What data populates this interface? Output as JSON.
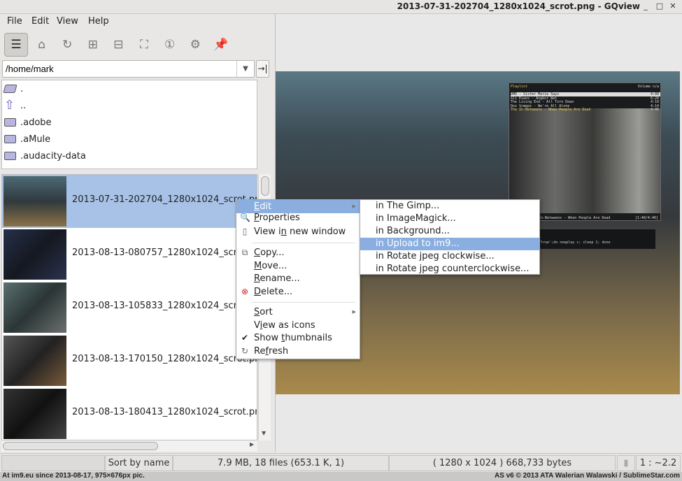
{
  "window": {
    "title": "2013-07-31-202704_1280x1024_scrot.png - GQview",
    "buttons": [
      "_",
      "□",
      "✕"
    ]
  },
  "menubar": [
    "File",
    "Edit",
    "View",
    "Help"
  ],
  "toolbar": [
    {
      "name": "thumbnails-toggle",
      "icon": "list-icon",
      "glyph": "☰",
      "active": true
    },
    {
      "name": "home",
      "icon": "home-icon",
      "glyph": "⌂"
    },
    {
      "name": "refresh",
      "icon": "refresh-icon",
      "glyph": "↻"
    },
    {
      "name": "zoom-in",
      "icon": "zoom-in-icon",
      "glyph": "⊞"
    },
    {
      "name": "zoom-out",
      "icon": "zoom-out-icon",
      "glyph": "⊟"
    },
    {
      "name": "zoom-fit",
      "icon": "fit-icon",
      "glyph": "⛶"
    },
    {
      "name": "zoom-1-1",
      "icon": "actual-size-icon",
      "glyph": "①"
    },
    {
      "name": "preferences",
      "icon": "preferences-icon",
      "glyph": "⚙"
    },
    {
      "name": "float",
      "icon": "pin-icon",
      "glyph": "📌"
    }
  ],
  "path": {
    "value": "/home/mark",
    "go_glyph": "→|"
  },
  "dirs": [
    {
      "name": ".",
      "icon": "open-folder-icon"
    },
    {
      "name": "..",
      "icon": "up-arrow-icon"
    },
    {
      "name": ".adobe",
      "icon": "folder-icon"
    },
    {
      "name": ".aMule",
      "icon": "folder-icon"
    },
    {
      "name": ".audacity-data",
      "icon": "folder-icon"
    }
  ],
  "files": [
    {
      "name": "2013-07-31-202704_1280x1024_scrot.png",
      "selected": true,
      "thumb": "linear-gradient(180deg,#4d6a74,#30393e 50%,#8a7246)"
    },
    {
      "name": "2013-08-13-080757_1280x1024_scrot.png",
      "thumb": "linear-gradient(135deg,#25304a,#151820 50%,#2a3350)"
    },
    {
      "name": "2013-08-13-105833_1280x1024_scrot.png",
      "thumb": "linear-gradient(135deg,#5a7070,#2b3535 50%,#6b7070)"
    },
    {
      "name": "2013-08-13-170150_1280x1024_scrot.png",
      "thumb": "linear-gradient(135deg,#555,#222 50%,#7a5a3a)"
    },
    {
      "name": "2013-08-13-180413_1280x1024_scrot.png",
      "thumb": "linear-gradient(135deg,#333,#111 50%,#444)"
    }
  ],
  "context_menu": {
    "items": [
      {
        "label": "Edit",
        "mn": "E",
        "highlight": true,
        "submenu": true
      },
      {
        "label": "Properties",
        "mn": "P",
        "icon": "properties-icon",
        "glyph": "🔍"
      },
      {
        "label": "View in new window",
        "mn": "n",
        "icon": "new-window-icon",
        "glyph": "▯"
      },
      {
        "sep": true
      },
      {
        "label": "Copy...",
        "mn": "C",
        "icon": "copy-icon",
        "glyph": "⧉"
      },
      {
        "label": "Move...",
        "mn": "M"
      },
      {
        "label": "Rename...",
        "mn": "R"
      },
      {
        "label": "Delete...",
        "mn": "D",
        "icon": "delete-icon",
        "glyph": "⊗"
      },
      {
        "sep": true
      },
      {
        "label": "Sort",
        "mn": "S",
        "submenu": true
      },
      {
        "label": "View as icons",
        "mn": "i"
      },
      {
        "label": "Show thumbnails",
        "mn": "t",
        "icon": "check-icon",
        "glyph": "✔"
      },
      {
        "label": "Refresh",
        "mn": "f",
        "icon": "refresh-icon",
        "glyph": "↻"
      }
    ],
    "edit_submenu": [
      "in The Gimp...",
      "in ImageMagick...",
      "in Background...",
      "in Upload to im9...",
      "in Rotate jpeg clockwise...",
      "in Rotate jpeg counterclockwise..."
    ],
    "edit_submenu_highlight": 3
  },
  "preview": {
    "player_title": "Playlist",
    "player_volume": "Volume n/a",
    "tracks": [
      [
        "DMD - Sister Marie Says",
        "4:00"
      ],
      [
        "Gli Evans - Angkor Wat",
        "6:26"
      ],
      [
        "The Living End - All Torn Down",
        "4:10"
      ],
      [
        "Doz Scmpps - We're All Alone",
        "4:14"
      ],
      [
        "The In-Betweens - When People Are Dead",
        "4:46"
      ]
    ],
    "now_playing": "The In-Betweens - When People Are Dead",
    "time": "[1:40/4:46]",
    "term_line1": "playing",
    "term_line2": "] while '/bin/true';do  nowplay c; sleep 1; done"
  },
  "status": {
    "sort": "Sort by name",
    "files": "7.9 MB, 18 files (653.1 K, 1)",
    "image": "( 1280 x 1024 ) 668,733 bytes",
    "zoom": "1 : ~2.2"
  },
  "watermark": {
    "left": "At im9.eu  since 2013-08-17, 975×676px pic.",
    "right": "AS v6 © 2013 ATA Walerian Walawski / SublimeStar.com"
  },
  "colors": {
    "selection": "#a7c2e6",
    "menu_highlight": "#8aaee0"
  }
}
